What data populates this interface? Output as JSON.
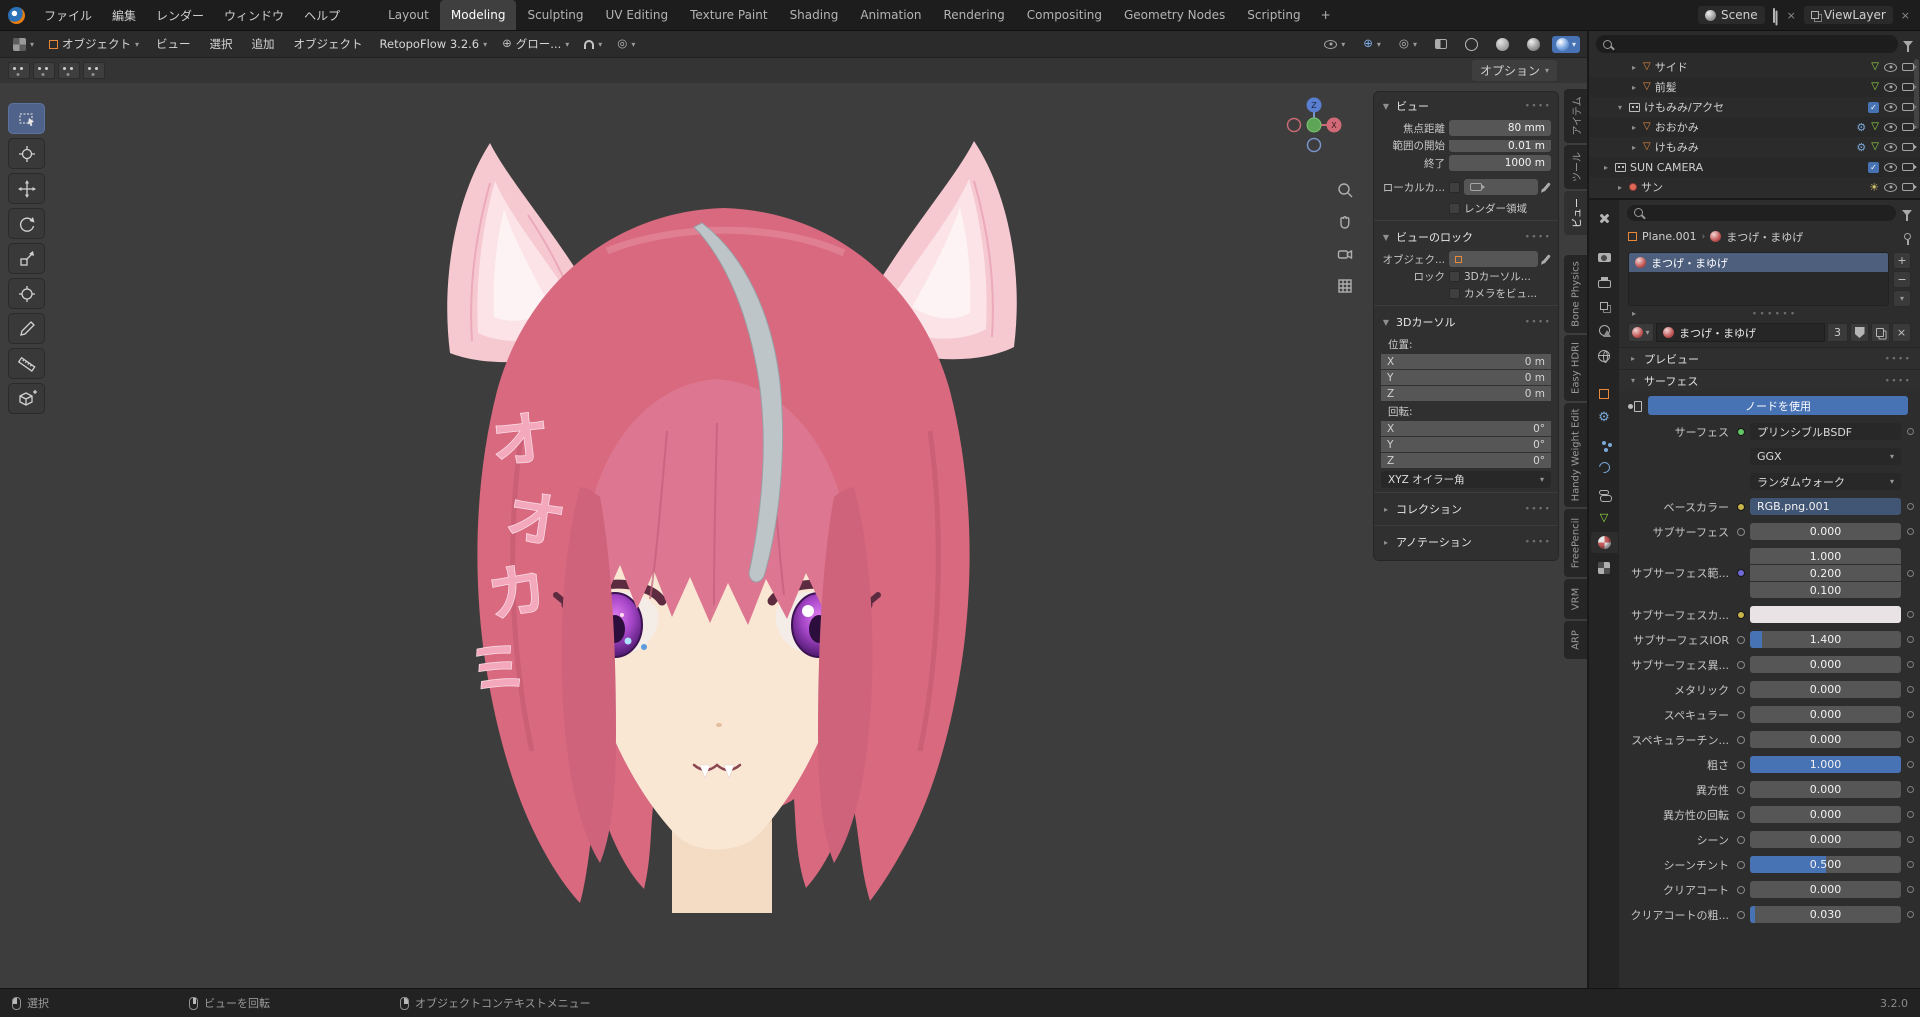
{
  "colors": {
    "accent": "#4772b3",
    "viewport_bg": "#3d3d3d",
    "header_bg": "#2b2b2b",
    "panel_bg": "#303030",
    "hair_pink": "#d8697f",
    "ear_pink": "#f6c9d1",
    "skin": "#f9e7d4",
    "iris_purple": "#a646c8",
    "streak_gray": "#bec5c9"
  },
  "topbar": {
    "menus": [
      "ファイル",
      "編集",
      "レンダー",
      "ウィンドウ",
      "ヘルプ"
    ],
    "workspaces": [
      "Layout",
      "Modeling",
      "Sculpting",
      "UV Editing",
      "Texture Paint",
      "Shading",
      "Animation",
      "Rendering",
      "Compositing",
      "Geometry Nodes",
      "Scripting"
    ],
    "add_workspace": "+",
    "active_workspace": "Modeling",
    "scene": "Scene",
    "view_layer": "ViewLayer"
  },
  "viewport": {
    "mode": "オブジェクト",
    "menus": [
      "ビュー",
      "選択",
      "追加",
      "オブジェクト"
    ],
    "addon_menu": "RetopoFlow 3.2.6",
    "orientation": "グロー...",
    "options": "オプション",
    "scene_text": "オオカミ",
    "scene_text_chars": [
      "オ",
      "オ",
      "カ",
      "ミ"
    ],
    "gizmo": {
      "z": "Z",
      "x": "X"
    }
  },
  "npanel": {
    "view": {
      "title": "ビュー",
      "focal_label": "焦点距離",
      "focal": "80 mm",
      "clip_start_label": "範囲の開始",
      "clip_start": "0.01 m",
      "clip_end_label": "終了",
      "clip_end": "1000 m",
      "local_camera": "ローカルカ...",
      "render_region": "レンダー領域"
    },
    "view_lock": {
      "title": "ビューのロック",
      "object": "オブジェク...",
      "lock": "ロック",
      "to_3d_cursor": "3Dカーソル...",
      "camera_to_view": "カメラをビュ..."
    },
    "cursor": {
      "title": "3Dカーソル",
      "location": "位置:",
      "rotation": "回転:",
      "x": "X",
      "y": "Y",
      "z": "Z",
      "loc_x": "0 m",
      "loc_y": "0 m",
      "loc_z": "0 m",
      "rot_x": "0°",
      "rot_y": "0°",
      "rot_z": "0°",
      "euler": "XYZ オイラー角"
    },
    "collections": "コレクション",
    "annotations": "アノテーション",
    "tabs": [
      "アイテム",
      "ツール",
      "ビュー"
    ],
    "active_tab": "ビュー",
    "addon_tabs": [
      "Bone Physics",
      "Easy HDRI",
      "Handy Weight Edit",
      "FreePencil",
      "VRM",
      "ARP"
    ]
  },
  "outliner": {
    "rows": [
      {
        "label": "サイド"
      },
      {
        "label": "前髪"
      },
      {
        "label": "けもみみ/アクセ"
      },
      {
        "label": "おおかみ"
      },
      {
        "label": "けもみみ"
      },
      {
        "label": "SUN CAMERA"
      },
      {
        "label": "サン"
      }
    ]
  },
  "properties": {
    "breadcrumb_object": "Plane.001",
    "breadcrumb_material": "まつげ・まゆげ",
    "slot_name": "まつげ・まゆげ",
    "material_name": "まつげ・まゆげ",
    "users_count": "3",
    "preview": "プレビュー",
    "surface": "サーフェス",
    "use_nodes": "ノードを使用",
    "surface_label": "サーフェス",
    "bsdf": "プリンシブルBSDF",
    "distribution": "GGX",
    "sss_method": "ランダムウォーク",
    "rows": [
      {
        "label": "ベースカラー",
        "value": "RGB.png.001"
      },
      {
        "label": "サブサーフェス",
        "value": "0.000",
        "fill": 0
      },
      {
        "label": "サブサーフェス範...",
        "v1": "1.000",
        "v2": "0.200",
        "v3": "0.100"
      },
      {
        "label": "サブサーフェスカ...",
        "swatch": "#e9e3e6"
      },
      {
        "label": "サブサーフェスIOR",
        "value": "1.400",
        "fill": 0.08
      },
      {
        "label": "サブサーフェス異...",
        "value": "0.000",
        "fill": 0
      },
      {
        "label": "メタリック",
        "value": "0.000",
        "fill": 0
      },
      {
        "label": "スペキュラー",
        "value": "0.000",
        "fill": 0
      },
      {
        "label": "スペキュラーチン...",
        "value": "0.000",
        "fill": 0
      },
      {
        "label": "粗さ",
        "value": "1.000",
        "fill": 1
      },
      {
        "label": "異方性",
        "value": "0.000",
        "fill": 0
      },
      {
        "label": "異方性の回転",
        "value": "0.000",
        "fill": 0
      },
      {
        "label": "シーン",
        "value": "0.000",
        "fill": 0
      },
      {
        "label": "シーンチント",
        "value": "0.500",
        "fill": 0.5
      },
      {
        "label": "クリアコート",
        "value": "0.000",
        "fill": 0
      },
      {
        "label": "クリアコートの粗...",
        "value": "0.030",
        "fill": 0.03
      }
    ]
  },
  "statusbar": {
    "left": "選択",
    "middle": "ビューを回転",
    "right": "オブジェクトコンテキストメニュー",
    "version": "3.2.0"
  }
}
